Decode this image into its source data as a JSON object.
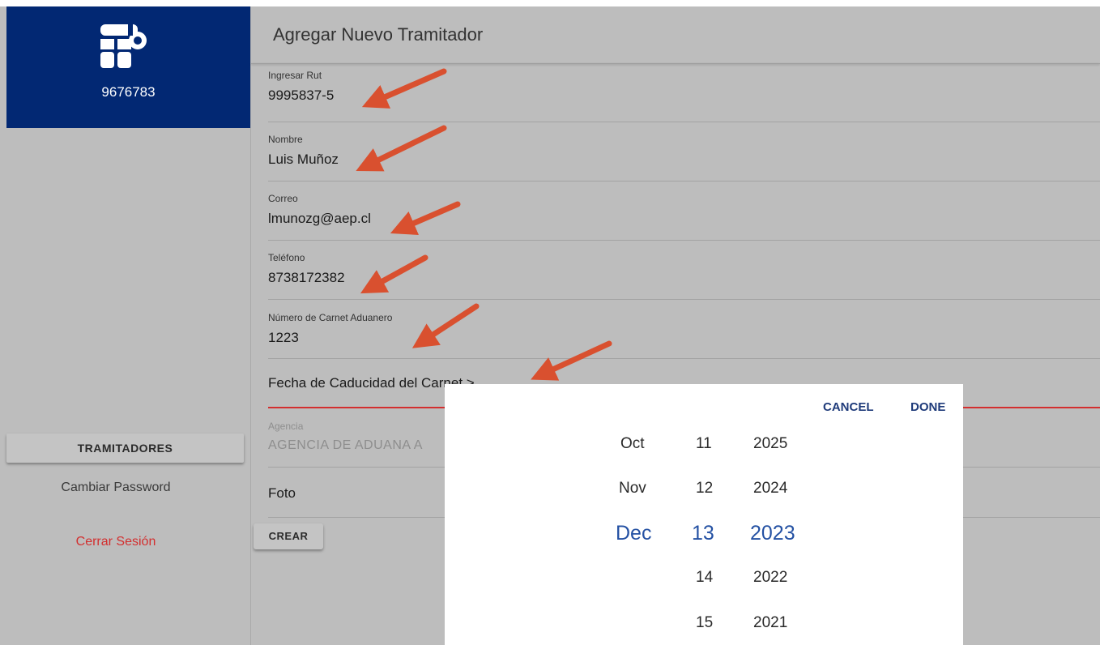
{
  "sidebar": {
    "user_id": "9676783",
    "nav_active": "TRAMITADORES",
    "change_password": "Cambiar Password",
    "logout": "Cerrar Sesión"
  },
  "page": {
    "title": "Agregar Nuevo Tramitador"
  },
  "form": {
    "rut": {
      "label": "Ingresar Rut",
      "value": "9995837-5"
    },
    "nombre": {
      "label": "Nombre",
      "value": "Luis Muñoz"
    },
    "correo": {
      "label": "Correo",
      "value": "lmunozg@aep.cl"
    },
    "telefono": {
      "label": "Teléfono",
      "value": "8738172382"
    },
    "carnet": {
      "label": "Número de Carnet Aduanero",
      "value": "1223"
    },
    "fecha_label": "Fecha de Caducidad del Carnet >",
    "agencia": {
      "label": "Agencia",
      "value": "AGENCIA DE ADUANA A"
    },
    "foto_label": "Foto",
    "crear_label": "CREAR"
  },
  "picker": {
    "cancel_label": "CANCEL",
    "done_label": "DONE",
    "months": [
      "Oct",
      "Nov",
      "Dec"
    ],
    "days": [
      "11",
      "12",
      "13",
      "14",
      "15"
    ],
    "years": [
      "2025",
      "2024",
      "2023",
      "2022",
      "2021"
    ],
    "selected": {
      "month": "Dec",
      "day": "13",
      "year": "2023"
    }
  },
  "colors": {
    "brand": "#022873",
    "annotation_arrow": "#d9502f",
    "focus_underline": "#d32f2f",
    "picker_selected": "#2451a3"
  }
}
